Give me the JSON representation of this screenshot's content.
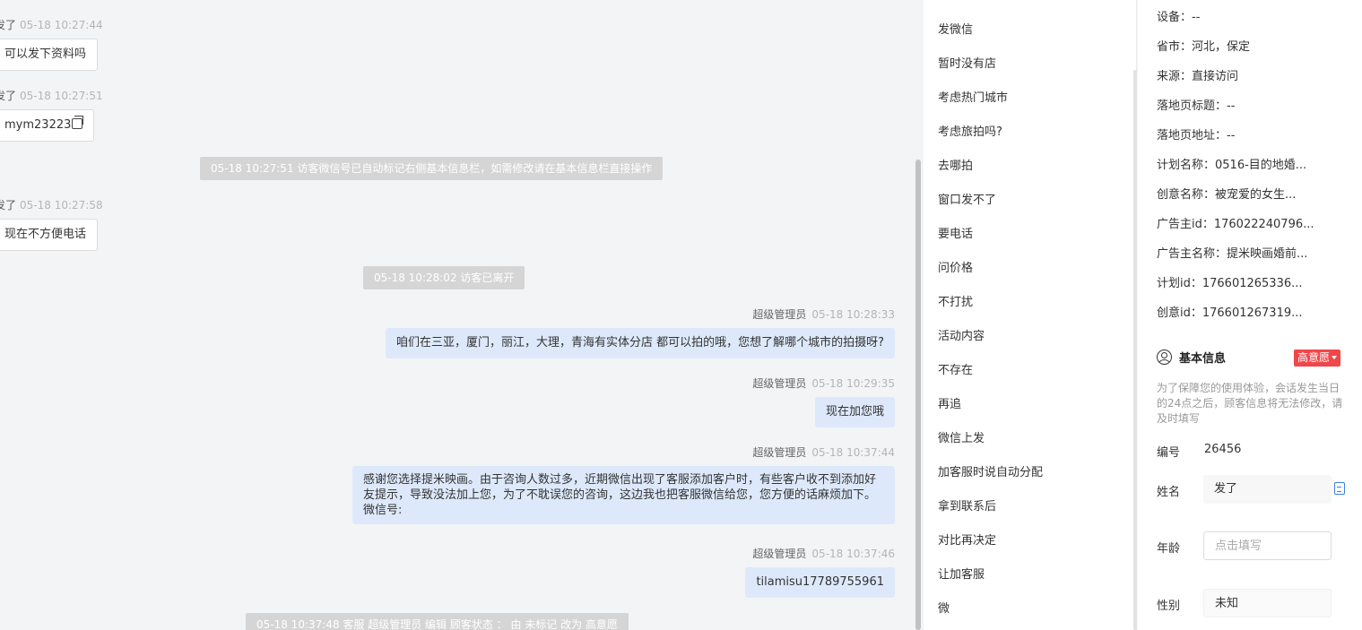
{
  "chat": {
    "visitor_messages": [
      {
        "name": "发了",
        "time": "05-18 10:27:44",
        "text": "可以发下资料吗"
      },
      {
        "name": "发了",
        "time": "05-18 10:27:51",
        "text": "mym23223"
      },
      {
        "name": "发了",
        "time": "05-18 10:27:58",
        "text": "现在不方便电话"
      }
    ],
    "system_messages": [
      "05-18 10:27:51 访客微信号已自动标记右侧基本信息栏，如需修改请在基本信息栏直接操作",
      "05-18 10:28:02 访客已离开",
      "05-18 10:37:48 客服 超级管理员 编辑 顾客状态 ： 由 未标记 改为 高意愿"
    ],
    "agent_messages": [
      {
        "name": "超级管理员",
        "time": "05-18 10:28:33",
        "text": "咱们在三亚，厦门，丽江，大理，青海有实体分店 都可以拍的哦，您想了解哪个城市的拍摄呀?"
      },
      {
        "name": "超级管理员",
        "time": "05-18 10:29:35",
        "text": "现在加您哦"
      },
      {
        "name": "超级管理员",
        "time": "05-18 10:37:44",
        "text": "感谢您选择提米映画。由于咨询人数过多，近期微信出现了客服添加客户时，有些客户收不到添加好友提示，导致没法加上您，为了不耽误您的咨询，这边我也把客服微信给您，您方便的话麻烦加下。微信号:"
      },
      {
        "name": "超级管理员",
        "time": "05-18 10:37:46",
        "text": "tilamisu17789755961"
      }
    ]
  },
  "quick_replies": [
    "发微信",
    "暂时没有店",
    "考虑热门城市",
    "考虑旅拍吗?",
    "去哪拍",
    "窗口发不了",
    "要电话",
    "问价格",
    "不打扰",
    "活动内容",
    "不存在",
    "再追",
    "微信上发",
    "加客服时说自动分配",
    "拿到联系后",
    "对比再决定",
    "让加客服",
    "微"
  ],
  "info": {
    "rows": [
      "设备：--",
      "省市：河北，保定",
      "来源：直接访问",
      "落地页标题：--",
      "落地页地址：--",
      "计划名称：0516-目的地婚...",
      "创意名称：被宠爱的女生...",
      "广告主id：176022240796...",
      "广告主名称：提米映画婚前...",
      "计划id：176601265336...",
      "创意id：176601267319..."
    ],
    "section_title": "基本信息",
    "intent_badge": "高意愿",
    "notice": "为了保障您的使用体验，会话发生当日的24点之后，顾客信息将无法修改，请及时填写",
    "fields": {
      "id_label": "编号",
      "id_value": "26456",
      "name_label": "姓名",
      "name_value": "发了",
      "age_label": "年龄",
      "age_placeholder": "点击填写",
      "gender_label": "性别",
      "gender_value": "未知"
    }
  }
}
